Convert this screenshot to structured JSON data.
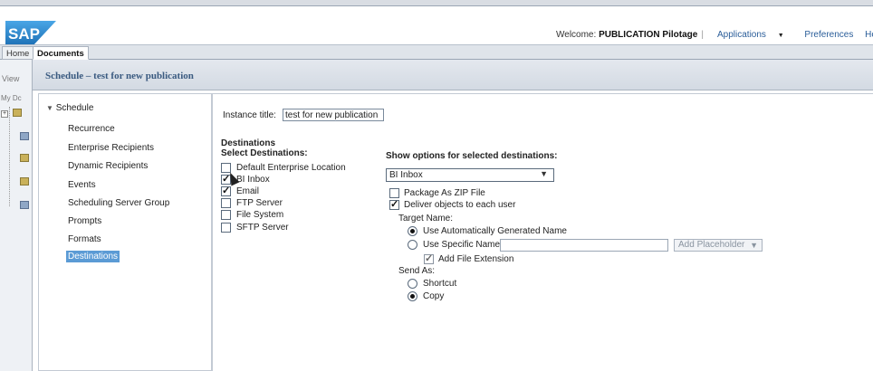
{
  "header": {
    "logo_text": "SAP",
    "welcome_label": "Welcome:",
    "user_name": "PUBLICATION Pilotage",
    "links": [
      "Applications",
      "Preferences",
      "Help me"
    ]
  },
  "tabs": [
    {
      "label": "Home"
    },
    {
      "label": "Documents"
    }
  ],
  "left_strip": {
    "view_label": "View",
    "folder_label": "My Dc"
  },
  "title": "Schedule – test for new publication",
  "nav": {
    "root": "Schedule",
    "items": [
      "Recurrence",
      "Enterprise Recipients",
      "Dynamic Recipients",
      "Events",
      "Scheduling Server Group",
      "Prompts",
      "Formats",
      "Destinations"
    ],
    "selected": "Destinations"
  },
  "instance": {
    "label": "Instance title:",
    "value": "test for new publication"
  },
  "destinations": {
    "heading": "Destinations",
    "select_label": "Select Destinations:",
    "options": [
      {
        "label": "Default Enterprise Location",
        "checked": false
      },
      {
        "label": "BI Inbox",
        "checked": true
      },
      {
        "label": "Email",
        "checked": true
      },
      {
        "label": "FTP Server",
        "checked": false
      },
      {
        "label": "File System",
        "checked": false
      },
      {
        "label": "SFTP Server",
        "checked": false
      }
    ]
  },
  "options_panel": {
    "heading": "Show options for selected destinations:",
    "selected_destination": "BI Inbox",
    "package_zip": {
      "label": "Package As ZIP File",
      "checked": false
    },
    "deliver_each": {
      "label": "Deliver objects to each user",
      "checked": true
    },
    "target_name_label": "Target Name:",
    "use_auto": "Use Automatically Generated Name",
    "use_specific": "Use Specific Name",
    "specific_name_value": "",
    "add_placeholder": "Add Placeholder",
    "add_extension": {
      "label": "Add File Extension",
      "checked": true
    },
    "send_as_label": "Send As:",
    "shortcut": "Shortcut",
    "copy": "Copy",
    "selected_send_as": "Copy",
    "selected_target": "auto"
  },
  "colors": {
    "accent": "#2a5d99",
    "selected_bg": "#5b9bd5",
    "title_text": "#3a5a80"
  }
}
